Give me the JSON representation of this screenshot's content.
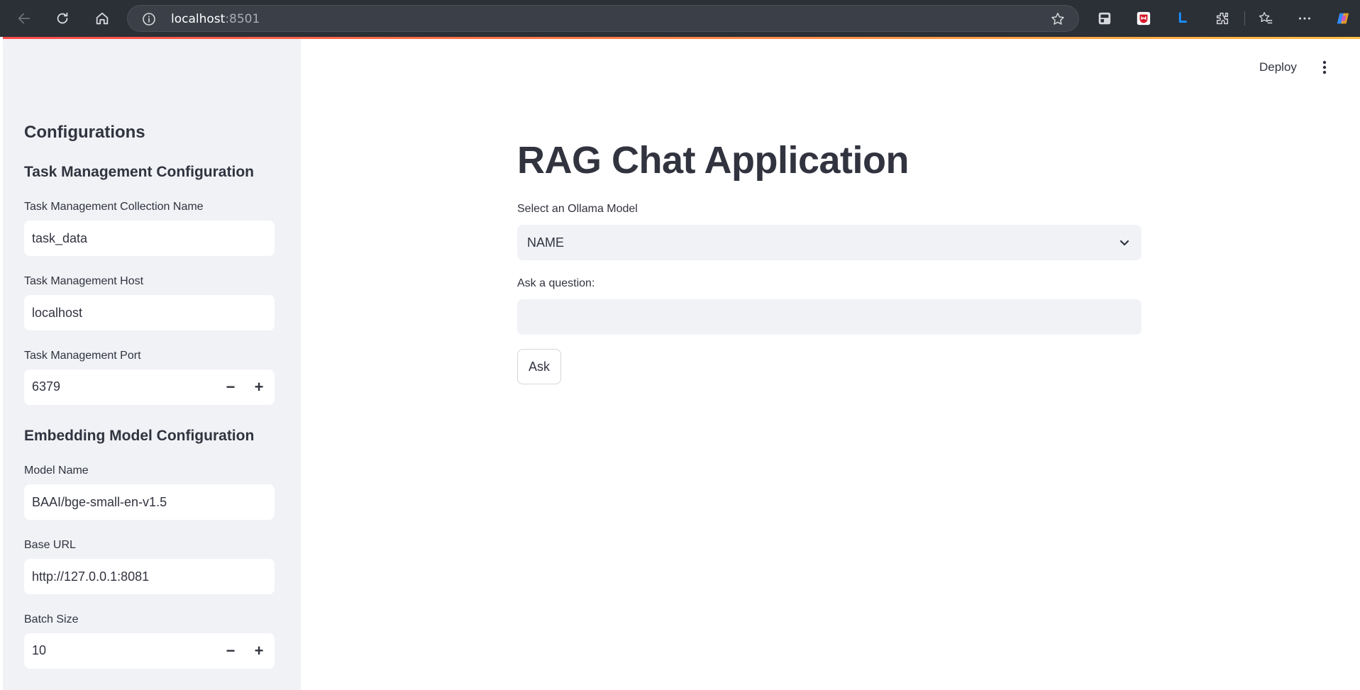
{
  "browser": {
    "url_host": "localhost",
    "url_port": ":8501",
    "icons": [
      "back-icon",
      "refresh-icon",
      "home-icon",
      "info-icon",
      "star-icon",
      "collections-icon",
      "shield-extension-icon",
      "l-extension-icon",
      "extensions-icon",
      "favorites-icon",
      "more-icon",
      "copilot-icon"
    ],
    "colors": {
      "chrome": "#2b2f36",
      "address": "#3b4048"
    }
  },
  "header": {
    "deploy_label": "Deploy"
  },
  "sidebar": {
    "heading": "Configurations",
    "task_section": {
      "title": "Task Management Configuration",
      "collection_label": "Task Management Collection Name",
      "collection_value": "task_data",
      "host_label": "Task Management Host",
      "host_value": "localhost",
      "port_label": "Task Management Port",
      "port_value": "6379"
    },
    "embedding_section": {
      "title": "Embedding Model Configuration",
      "model_label": "Model Name",
      "model_value": "BAAI/bge-small-en-v1.5",
      "base_url_label": "Base URL",
      "base_url_value": "http://127.0.0.1:8081",
      "batch_label": "Batch Size",
      "batch_value": "10"
    },
    "stepper": {
      "minus": "−",
      "plus": "+"
    }
  },
  "main": {
    "title": "RAG Chat Application",
    "model_select_label": "Select an Ollama Model",
    "model_select_value": "NAME",
    "question_label": "Ask a question:",
    "question_value": "",
    "ask_label": "Ask"
  },
  "colors": {
    "sidebar_bg": "#f0f2f6",
    "text": "#31333f",
    "accent_gradient": [
      "#ff4b4b",
      "#ffbd45"
    ]
  }
}
